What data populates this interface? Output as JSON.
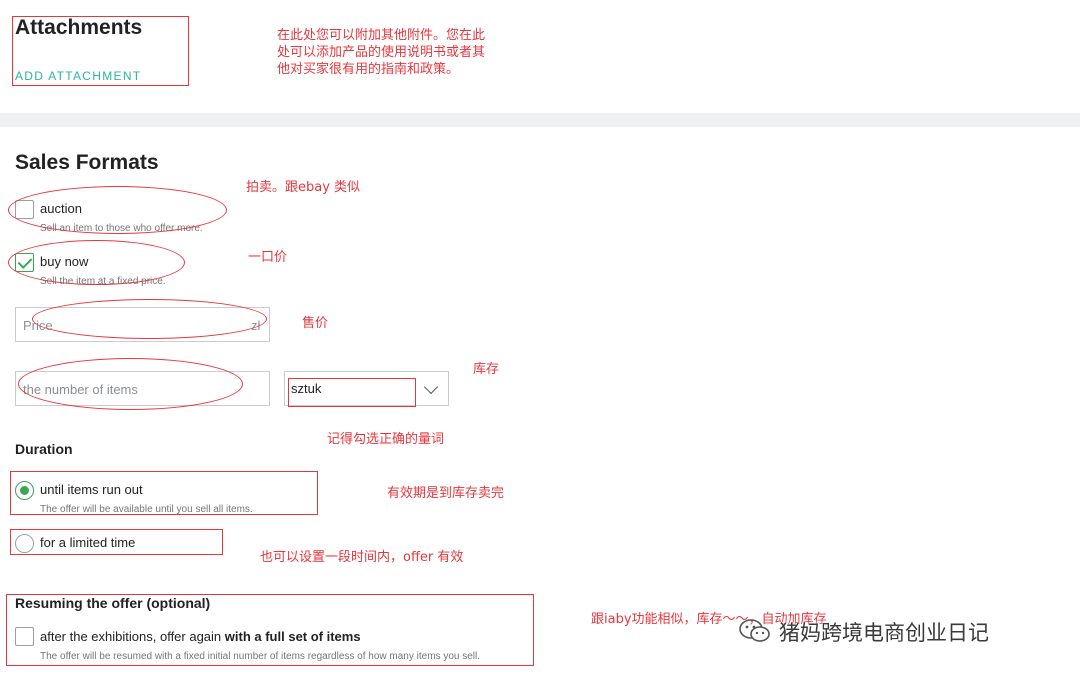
{
  "attachments": {
    "title": "Attachments",
    "add_link": "ADD ATTACHMENT",
    "note": "在此处您可以附加其他附件。您在此处可以添加产品的使用说明书或者其他对买家很有用的指南和政策。"
  },
  "sales_formats": {
    "title": "Sales Formats",
    "auction": {
      "label": "auction",
      "hint": "Sell an item to those who offer more.",
      "checked": false,
      "note": "拍卖。跟ebay 类似"
    },
    "buy_now": {
      "label": "buy now",
      "hint": "Sell the item at a fixed price.",
      "checked": true,
      "note": "一口价"
    },
    "price": {
      "placeholder": "Price",
      "currency": "zł",
      "note": "售价"
    },
    "quantity": {
      "placeholder": "the number of items",
      "unit_value": "sztuk",
      "note": "库存",
      "unit_note": "记得勾选正确的量词"
    }
  },
  "duration": {
    "title": "Duration",
    "until_run_out": {
      "label": "until items run out",
      "hint": "The offer will be available until you sell all items.",
      "selected": true,
      "note": "有效期是到库存卖完"
    },
    "limited_time": {
      "label": "for a limited time",
      "selected": false,
      "note": "也可以设置一段时间内，offer 有效"
    }
  },
  "resuming": {
    "title": "Resuming the offer (optional)",
    "label_prefix": "after the exhibitions, offer again ",
    "label_bold": "with a full set of items",
    "hint": "The offer will be resumed with a fixed initial number of items regardless of how many items you sell.",
    "checked": false,
    "note": "跟iaby功能相似，库存〜〜，自动加库存"
  },
  "watermark": {
    "text": "猪妈跨境电商创业日记",
    "icon": "wechat-icon"
  },
  "colors": {
    "accent": "#2bb3a3",
    "check_green": "#3aa757",
    "annotation_red": "#e8363d"
  }
}
